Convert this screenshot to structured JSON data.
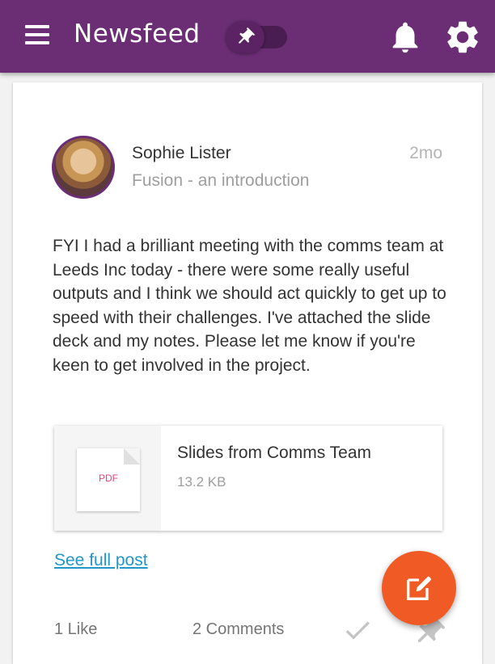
{
  "appbar": {
    "title": "Newsfeed",
    "menu_icon": "menu-icon",
    "pin_toggle_icon": "pin-icon",
    "notifications_icon": "bell-icon",
    "settings_icon": "gear-icon",
    "background_color": "#6b2e75"
  },
  "post": {
    "author": "Sophie Lister",
    "subject": "Fusion - an introduction",
    "time": "2mo",
    "body": "FYI I had a brilliant meeting with the comms team at Leeds Inc today - there were some really useful outputs and I think we should act quickly to get up to speed with their challenges. I've attached the slide deck and my notes. Please let me know if you're keen to get involved in the project.",
    "attachment": {
      "type_label": "PDF",
      "name": "Slides from Comms Team",
      "size": "13.2 KB"
    },
    "see_full_link": "See full post",
    "likes": "1 Like",
    "comments": "2 Comments",
    "accent_link_color": "#2196c9"
  },
  "fab": {
    "icon": "edit-icon",
    "color": "#f05a24"
  }
}
